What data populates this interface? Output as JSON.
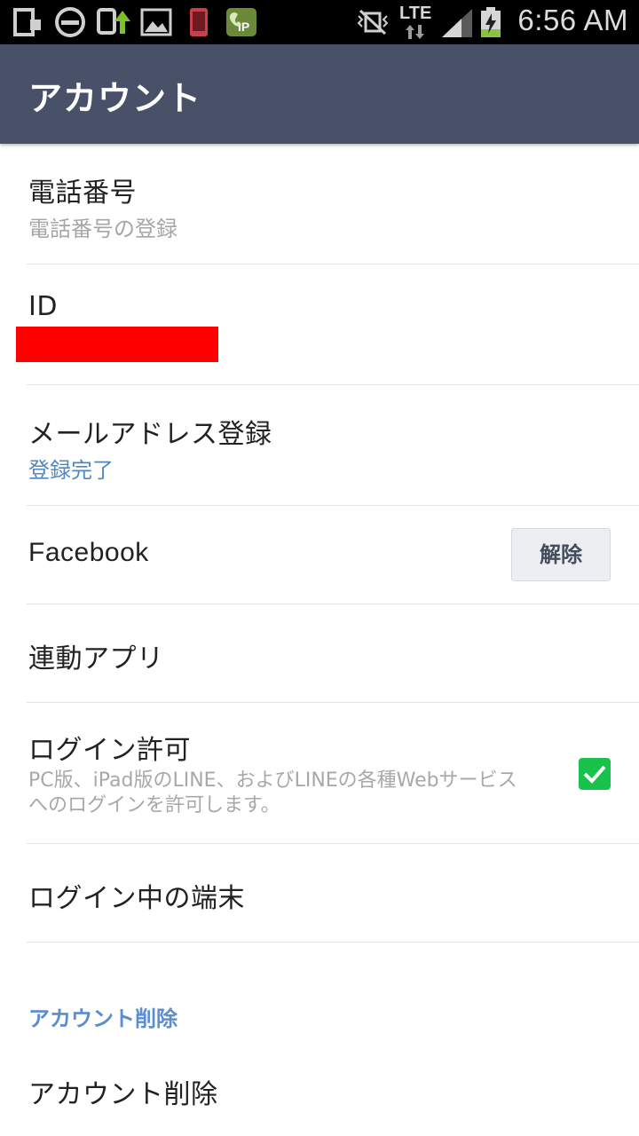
{
  "status_bar": {
    "network": "LTE",
    "time": "6:56 AM",
    "icons": [
      "sim-icon",
      "do-not-disturb-icon",
      "upload-icon",
      "image-icon",
      "phone-icon",
      "ip-call-icon",
      "vibrate-icon",
      "signal-icon",
      "battery-charging-icon"
    ]
  },
  "header": {
    "title": "アカウント"
  },
  "rows": {
    "phone": {
      "title": "電話番号",
      "subtitle": "電話番号の登録"
    },
    "id": {
      "title": "ID"
    },
    "email": {
      "title": "メールアドレス登録",
      "subtitle": "登録完了"
    },
    "facebook": {
      "title": "Facebook",
      "button_label": "解除"
    },
    "linked_apps": {
      "title": "連動アプリ"
    },
    "login_permission": {
      "title": "ログイン許可",
      "description_line1": "PC版、iPad版のLINE、およびLINEの各種Webサービス",
      "description_line2": "へのログインを許可します。",
      "checked": true
    },
    "logged_in_devices": {
      "title": "ログイン中の端末"
    }
  },
  "delete_section": {
    "header": "アカウント削除",
    "item": "アカウント削除"
  },
  "colors": {
    "header_bg": "#485168",
    "accent_blue": "#4f86c6",
    "checkbox_green": "#19c24a",
    "redaction": "#ff0000"
  }
}
